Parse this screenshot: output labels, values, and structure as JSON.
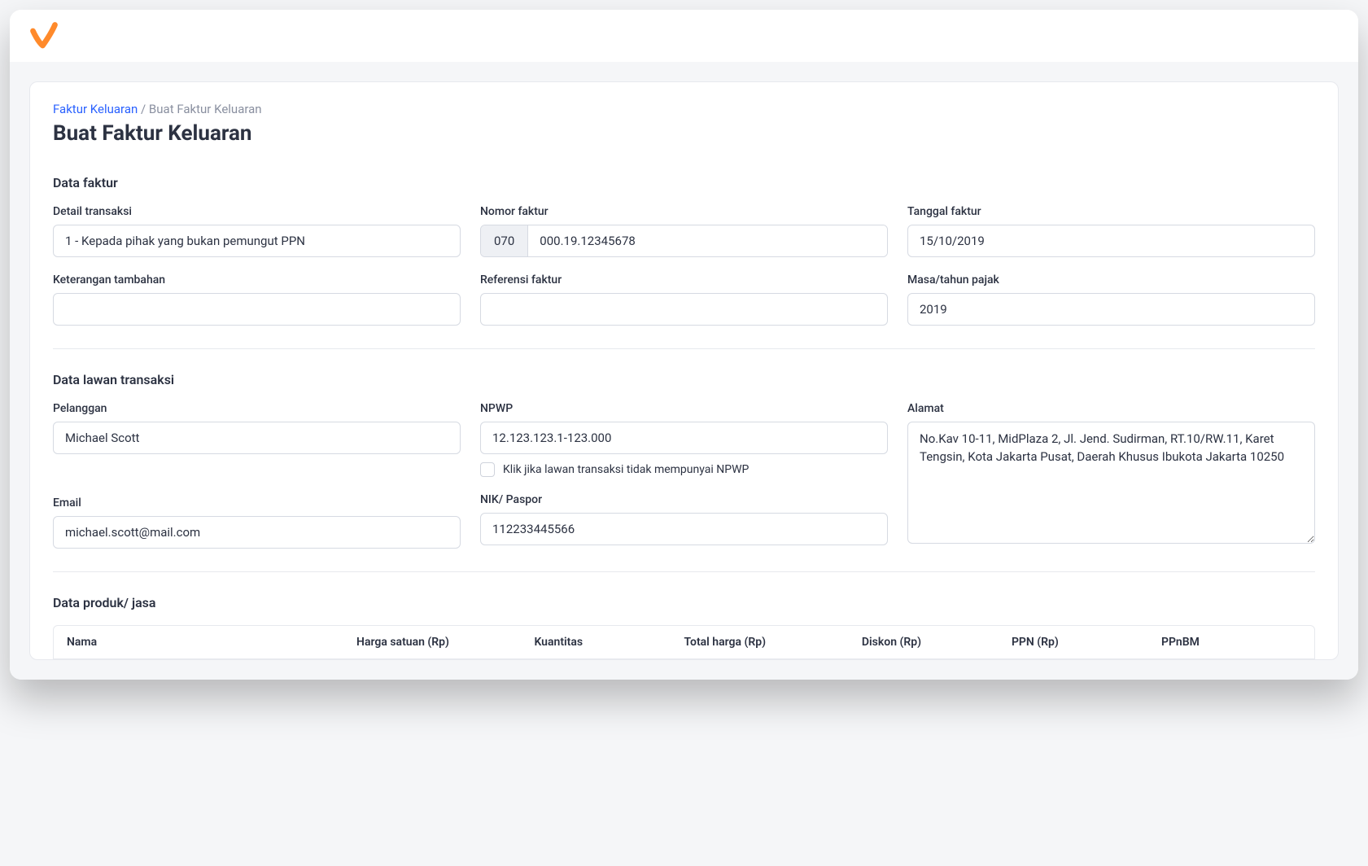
{
  "breadcrumb": {
    "parent": "Faktur Keluaran",
    "separator": " / ",
    "current": "Buat Faktur Keluaran"
  },
  "page_title": "Buat Faktur Keluaran",
  "section_faktur": {
    "title": "Data faktur",
    "detail_transaksi": {
      "label": "Detail transaksi",
      "value": "1 - Kepada pihak yang bukan pemungut PPN"
    },
    "nomor_faktur": {
      "label": "Nomor faktur",
      "prefix": "070",
      "value": "000.19.12345678"
    },
    "tanggal_faktur": {
      "label": "Tanggal faktur",
      "value": "15/10/2019"
    },
    "keterangan_tambahan": {
      "label": "Keterangan tambahan",
      "value": ""
    },
    "referensi_faktur": {
      "label": "Referensi faktur",
      "value": ""
    },
    "masa_tahun_pajak": {
      "label": "Masa/tahun pajak",
      "value": "2019"
    }
  },
  "section_lawan": {
    "title": "Data lawan transaksi",
    "pelanggan": {
      "label": "Pelanggan",
      "value": "Michael Scott"
    },
    "npwp": {
      "label": "NPWP",
      "value": "12.123.123.1-123.000",
      "checkbox_label": "Klik jika lawan transaksi tidak mempunyai NPWP"
    },
    "alamat": {
      "label": "Alamat",
      "value": "No.Kav 10-11, MidPlaza 2, Jl. Jend. Sudirman, RT.10/RW.11, Karet Tengsin, Kota Jakarta Pusat, Daerah Khusus Ibukota Jakarta 10250"
    },
    "email": {
      "label": "Email",
      "value": "michael.scott@mail.com"
    },
    "nik_paspor": {
      "label": "NIK/ Paspor",
      "value": "112233445566"
    }
  },
  "section_produk": {
    "title": "Data produk/ jasa",
    "columns": {
      "nama": "Nama",
      "harga_satuan": "Harga satuan (Rp)",
      "kuantitas": "Kuantitas",
      "total_harga": "Total harga (Rp)",
      "diskon": "Diskon (Rp)",
      "ppn": "PPN (Rp)",
      "ppnbm": "PPnBM"
    }
  },
  "colors": {
    "accent": "#ff7a1a",
    "link": "#2b62ff"
  }
}
